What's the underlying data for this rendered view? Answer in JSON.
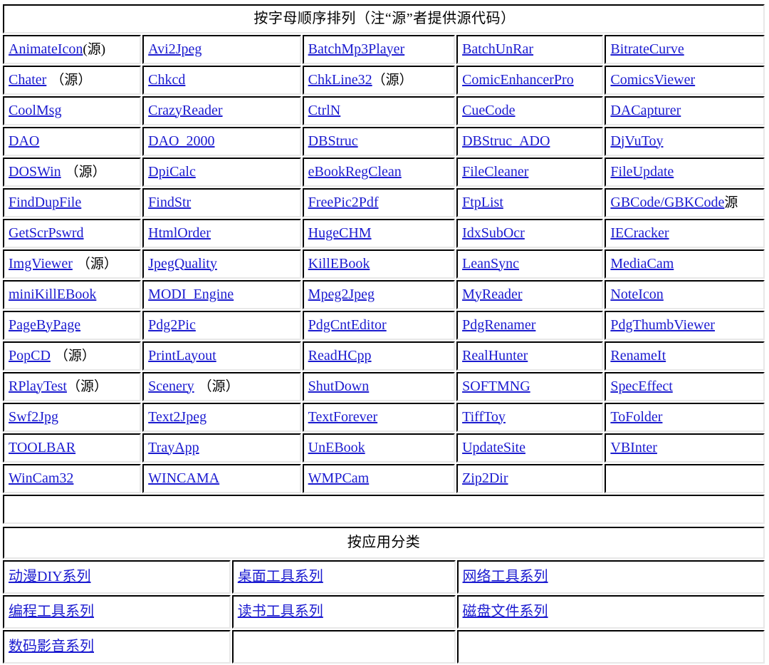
{
  "alpha_section": {
    "banner": "按字母顺序排列（注“源”者提供源代码）",
    "rows": [
      [
        {
          "link": "AnimateIcon",
          "suffix": "(源)"
        },
        {
          "link": "Avi2Jpeg",
          "suffix": ""
        },
        {
          "link": "BatchMp3Player",
          "suffix": ""
        },
        {
          "link": "BatchUnRar",
          "suffix": ""
        },
        {
          "link": "BitrateCurve",
          "suffix": ""
        }
      ],
      [
        {
          "link": "Chater",
          "suffix": "（源）",
          "spaced": true
        },
        {
          "link": "Chkcd",
          "suffix": ""
        },
        {
          "link": "ChkLine32",
          "suffix": "（源）"
        },
        {
          "link": "ComicEnhancerPro",
          "suffix": ""
        },
        {
          "link": "ComicsViewer",
          "suffix": ""
        }
      ],
      [
        {
          "link": "CoolMsg",
          "suffix": ""
        },
        {
          "link": "CrazyReader",
          "suffix": ""
        },
        {
          "link": "CtrlN",
          "suffix": ""
        },
        {
          "link": "CueCode",
          "suffix": ""
        },
        {
          "link": "DACapturer",
          "suffix": ""
        }
      ],
      [
        {
          "link": "DAO",
          "suffix": ""
        },
        {
          "link": "DAO_2000",
          "suffix": ""
        },
        {
          "link": "DBStruc",
          "suffix": ""
        },
        {
          "link": "DBStruc_ADO",
          "suffix": ""
        },
        {
          "link": "DjVuToy",
          "suffix": ""
        }
      ],
      [
        {
          "link": "DOSWin",
          "suffix": "（源）",
          "spaced": true
        },
        {
          "link": "DpiCalc",
          "suffix": ""
        },
        {
          "link": "eBookRegClean",
          "suffix": ""
        },
        {
          "link": "FileCleaner",
          "suffix": ""
        },
        {
          "link": "FileUpdate",
          "suffix": ""
        }
      ],
      [
        {
          "link": "FindDupFile",
          "suffix": ""
        },
        {
          "link": "FindStr",
          "suffix": ""
        },
        {
          "link": "FreePic2Pdf",
          "suffix": ""
        },
        {
          "link": "FtpList",
          "suffix": ""
        },
        {
          "link": "GBCode/GBKCode",
          "suffix": "源"
        }
      ],
      [
        {
          "link": "GetScrPswrd",
          "suffix": ""
        },
        {
          "link": "HtmlOrder",
          "suffix": ""
        },
        {
          "link": "HugeCHM",
          "suffix": ""
        },
        {
          "link": "IdxSubOcr",
          "suffix": ""
        },
        {
          "link": "IECracker",
          "suffix": ""
        }
      ],
      [
        {
          "link": "ImgViewer",
          "suffix": "（源）",
          "spaced": true
        },
        {
          "link": "JpegQuality",
          "suffix": ""
        },
        {
          "link": "KillEBook",
          "suffix": ""
        },
        {
          "link": "LeanSync",
          "suffix": ""
        },
        {
          "link": "MediaCam",
          "suffix": ""
        }
      ],
      [
        {
          "link": "miniKillEBook",
          "suffix": ""
        },
        {
          "link": "MODI_Engine",
          "suffix": ""
        },
        {
          "link": "Mpeg2Jpeg",
          "suffix": ""
        },
        {
          "link": "MyReader",
          "suffix": ""
        },
        {
          "link": "NoteIcon",
          "suffix": ""
        }
      ],
      [
        {
          "link": "PageByPage",
          "suffix": ""
        },
        {
          "link": "Pdg2Pic",
          "suffix": ""
        },
        {
          "link": "PdgCntEditor",
          "suffix": ""
        },
        {
          "link": "PdgRenamer",
          "suffix": ""
        },
        {
          "link": "PdgThumbViewer",
          "suffix": ""
        }
      ],
      [
        {
          "link": "PopCD",
          "suffix": "（源）",
          "spaced": true
        },
        {
          "link": "PrintLayout",
          "suffix": ""
        },
        {
          "link": "ReadHCpp",
          "suffix": ""
        },
        {
          "link": "RealHunter",
          "suffix": ""
        },
        {
          "link": "RenameIt",
          "suffix": ""
        }
      ],
      [
        {
          "link": "RPlayTest",
          "suffix": "（源）"
        },
        {
          "link": "Scenery",
          "suffix": "（源）",
          "spaced": true
        },
        {
          "link": "ShutDown",
          "suffix": ""
        },
        {
          "link": "SOFTMNG",
          "suffix": ""
        },
        {
          "link": "SpecEffect",
          "suffix": ""
        }
      ],
      [
        {
          "link": "Swf2Jpg",
          "suffix": ""
        },
        {
          "link": "Text2Jpeg",
          "suffix": ""
        },
        {
          "link": "TextForever",
          "suffix": ""
        },
        {
          "link": "TiffToy",
          "suffix": ""
        },
        {
          "link": "ToFolder",
          "suffix": ""
        }
      ],
      [
        {
          "link": "TOOLBAR",
          "suffix": ""
        },
        {
          "link": "TrayApp",
          "suffix": ""
        },
        {
          "link": "UnEBook",
          "suffix": ""
        },
        {
          "link": "UpdateSite",
          "suffix": ""
        },
        {
          "link": "VBInter",
          "suffix": ""
        }
      ],
      [
        {
          "link": "WinCam32",
          "suffix": ""
        },
        {
          "link": "WINCAMA",
          "suffix": ""
        },
        {
          "link": "WMPCam",
          "suffix": ""
        },
        {
          "link": "Zip2Dir",
          "suffix": ""
        },
        {
          "link": "",
          "suffix": ""
        }
      ]
    ]
  },
  "category_section": {
    "banner": "按应用分类",
    "rows": [
      [
        {
          "link": "动漫DIY系列"
        },
        {
          "link": "桌面工具系列"
        },
        {
          "link": "网络工具系列"
        }
      ],
      [
        {
          "link": "编程工具系列"
        },
        {
          "link": "读书工具系列"
        },
        {
          "link": "磁盘文件系列"
        }
      ],
      [
        {
          "link": "数码影音系列"
        },
        {
          "link": ""
        },
        {
          "link": ""
        }
      ]
    ]
  },
  "colors": {
    "banner_bg": "#7ffbfb",
    "link": "#1b1bd0",
    "page_bg": "#ffffff"
  }
}
